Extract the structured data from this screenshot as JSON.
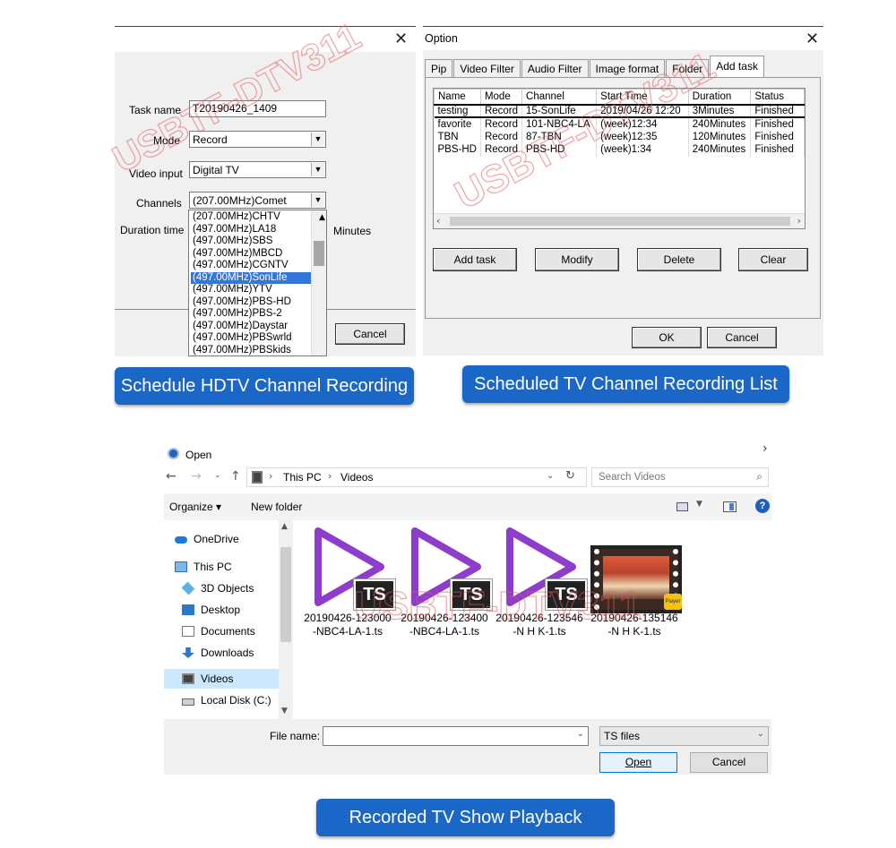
{
  "dlg1": {
    "task_name_label": "Task name",
    "task_name_value": "T20190426_1409",
    "mode_label": "Mode",
    "mode_value": "Record",
    "video_input_label": "Video input",
    "video_input_value": "Digital TV",
    "channels_label": "Channels",
    "channels_value": "(207.00MHz)Comet",
    "duration_label": "Duration time",
    "minutes_label": "Minutes",
    "channel_options": [
      "(207.00MHz)CHTV",
      "(497.00MHz)LA18",
      "(497.00MHz)SBS",
      "(497.00MHz)MBCD",
      "(497.00MHz)CGNTV",
      "(497.00MHz)SonLife",
      "(497.00MHz)YTV",
      "(497.00MHz)PBS-HD",
      "(497.00MHz)PBS-2",
      "(497.00MHz)Daystar",
      "(497.00MHz)PBSwrld",
      "(497.00MHz)PBSkids"
    ],
    "selected_option": "(497.00MHz)SonLife",
    "cancel_label": "Cancel",
    "caption": "Schedule HDTV Channel Recording"
  },
  "dlg2": {
    "title": "Option",
    "tabs": [
      "Pip",
      "Video Filter",
      "Audio Filter",
      "Image format",
      "Folder",
      "Add task"
    ],
    "active_tab": "Add task",
    "columns": [
      "Name",
      "Mode",
      "Channel",
      "Start Time",
      "Duration",
      "Status"
    ],
    "rows": [
      [
        "testing",
        "Record",
        "15-SonLife",
        "2019/04/26 12:20",
        "3Minutes",
        "Finished"
      ],
      [
        "favorite",
        "Record",
        "101-NBC4-LA",
        "(week)12:34",
        "240Minutes",
        "Finished"
      ],
      [
        "TBN",
        "Record",
        "87-TBN",
        "(week)12:35",
        "120Minutes",
        "Finished"
      ],
      [
        "PBS-HD",
        "Record",
        "PBS-HD",
        "(week)1:34",
        "240Minutes",
        "Finished"
      ]
    ],
    "buttons": {
      "add_task": "Add task",
      "modify": "Modify",
      "delete": "Delete",
      "clear": "Clear",
      "ok": "OK",
      "cancel": "Cancel"
    },
    "caption": "Scheduled TV Channel Recording List"
  },
  "explorer": {
    "title": "Open",
    "breadcrumb": [
      "This PC",
      "Videos"
    ],
    "search_placeholder": "Search Videos",
    "organize_label": "Organize ▾",
    "new_folder_label": "New folder",
    "nav": [
      {
        "label": "OneDrive",
        "icon": "cloud-icon"
      },
      {
        "label": "This PC",
        "icon": "computer-icon"
      },
      {
        "label": "3D Objects",
        "icon": "cube-icon"
      },
      {
        "label": "Desktop",
        "icon": "desktop-icon"
      },
      {
        "label": "Documents",
        "icon": "document-icon"
      },
      {
        "label": "Downloads",
        "icon": "download-icon"
      },
      {
        "label": "Videos",
        "icon": "video-folder-icon"
      },
      {
        "label": "Local Disk (C:)",
        "icon": "disk-icon"
      }
    ],
    "selected_nav": "Videos",
    "files": [
      {
        "line1": "20190426-123000",
        "line2": "-NBC4-LA-1.ts",
        "badge": "TS"
      },
      {
        "line1": "20190426-123400",
        "line2": "-NBC4-LA-1.ts",
        "badge": "TS"
      },
      {
        "line1": "20190426-123546",
        "line2": "-N H K-1.ts",
        "badge": "TS"
      },
      {
        "line1": "20190426-135146",
        "line2": "-N H K-1.ts",
        "badge": "Player"
      }
    ],
    "file_name_label": "File name:",
    "file_name_value": "",
    "file_type_value": "TS files",
    "open_label": "Open",
    "cancel_label": "Cancel",
    "caption": "Recorded TV Show Playback"
  },
  "watermark": "USBTF-DTV311",
  "colors": {
    "caption_blue": "#1a67c8",
    "play_purple": "#8e3ccb",
    "select_blue": "#3377dd"
  }
}
